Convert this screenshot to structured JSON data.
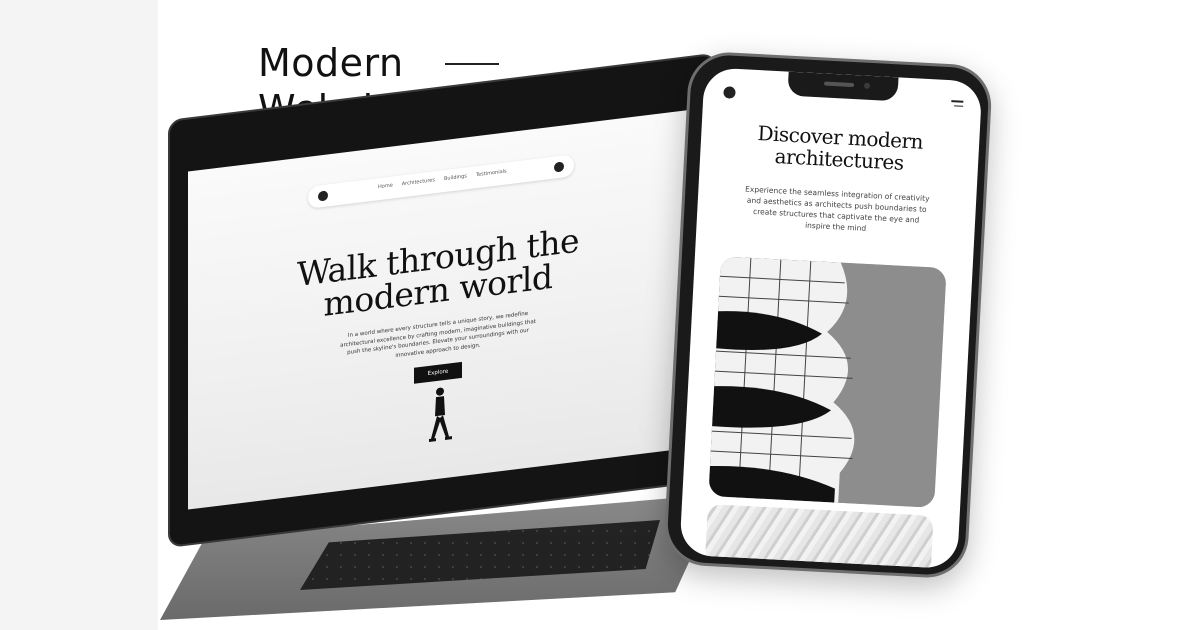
{
  "headline": {
    "line1": "Modern",
    "line2": "Website"
  },
  "laptop_site": {
    "nav": [
      "Home",
      "Architectures",
      "Buildings",
      "Testimonials"
    ],
    "hero_title_line1": "Walk through the",
    "hero_title_line2": "modern world",
    "hero_text": "In a world where every structure tells a unique story, we redefine architectural excellence by crafting modern, imaginative buildings that push the skyline's boundaries. Elevate your surroundings with our innovative approach to design.",
    "cta": "Explore"
  },
  "phone_site": {
    "title_line1": "Discover modern",
    "title_line2": "architectures",
    "text": "Experience the seamless integration of creativity and aesthetics as architects push boundaries to create structures that captivate the eye and inspire the mind"
  },
  "colors": {
    "dark": "#111111",
    "device": "#1a1a1a",
    "strip": "#f4f4f4"
  }
}
